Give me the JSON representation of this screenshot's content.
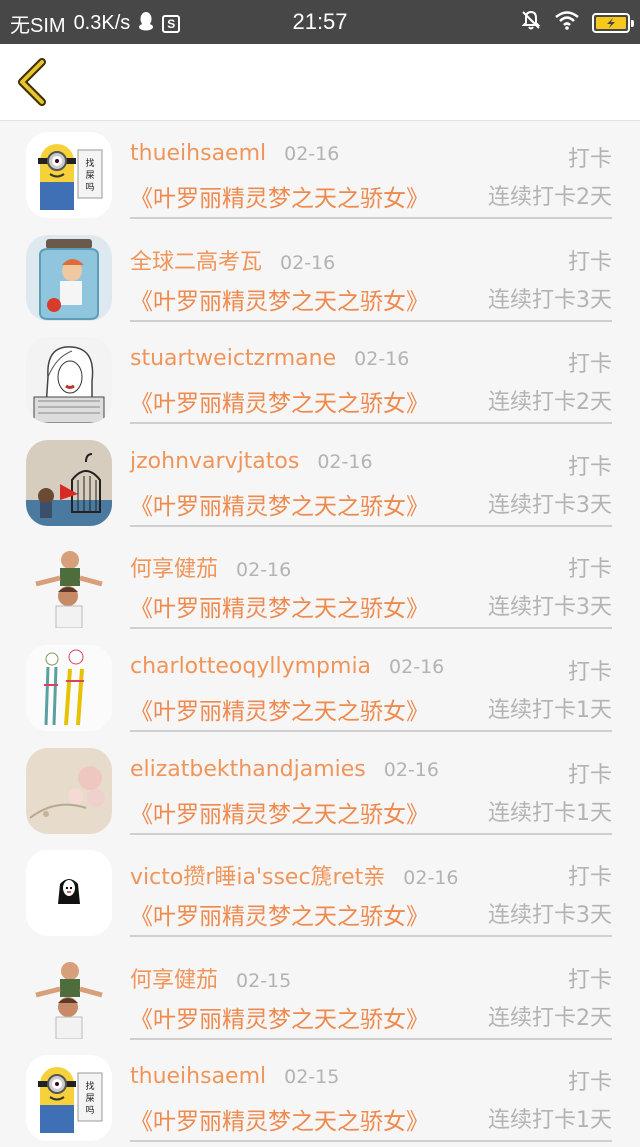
{
  "status_bar": {
    "carrier": "无SIM",
    "speed": "0.3K/s",
    "box_icon_letter": "S",
    "time": "21:57"
  },
  "colors": {
    "accent": "#f0955a",
    "muted": "#b3b3b3",
    "back_arrow": "#e9c230"
  },
  "records": [
    {
      "username": "thueihsaeml",
      "date": "02-16",
      "action": "打卡",
      "book": "《叶罗丽精灵梦之天之骄女》",
      "streak": "连续打卡2天",
      "avatar": "minion-avatar"
    },
    {
      "username": "全球二高考瓦",
      "date": "02-16",
      "action": "打卡",
      "book": "《叶罗丽精灵梦之天之骄女》",
      "streak": "连续打卡3天",
      "avatar": "jar-avatar"
    },
    {
      "username": "stuartweictzrmane",
      "date": "02-16",
      "action": "打卡",
      "book": "《叶罗丽精灵梦之天之骄女》",
      "streak": "连续打卡2天",
      "avatar": "sketch-girl-avatar"
    },
    {
      "username": "jzohnvarvjtatos",
      "date": "02-16",
      "action": "打卡",
      "book": "《叶罗丽精灵梦之天之骄女》",
      "streak": "连续打卡3天",
      "avatar": "birdcage-avatar"
    },
    {
      "username": "何享健茄",
      "date": "02-16",
      "action": "打卡",
      "book": "《叶罗丽精灵梦之天之骄女》",
      "streak": "连续打卡3天",
      "avatar": "family-avatar"
    },
    {
      "username": "charlotteoqyllympmia",
      "date": "02-16",
      "action": "打卡",
      "book": "《叶罗丽精灵梦之天之骄女》",
      "streak": "连续打卡1天",
      "avatar": "legs-drawing-avatar"
    },
    {
      "username": "elizatbekthandjamies",
      "date": "02-16",
      "action": "打卡",
      "book": "《叶罗丽精灵梦之天之骄女》",
      "streak": "连续打卡1天",
      "avatar": "flower-avatar"
    },
    {
      "username": "victo攒r睡ia'ssec篪ret亲",
      "date": "02-16",
      "action": "打卡",
      "book": "《叶罗丽精灵梦之天之骄女》",
      "streak": "连续打卡3天",
      "avatar": "no-face-avatar"
    },
    {
      "username": "何享健茄",
      "date": "02-15",
      "action": "打卡",
      "book": "《叶罗丽精灵梦之天之骄女》",
      "streak": "连续打卡2天",
      "avatar": "family-avatar"
    },
    {
      "username": "thueihsaeml",
      "date": "02-15",
      "action": "打卡",
      "book": "《叶罗丽精灵梦之天之骄女》",
      "streak": "连续打卡1天",
      "avatar": "minion-avatar"
    }
  ]
}
